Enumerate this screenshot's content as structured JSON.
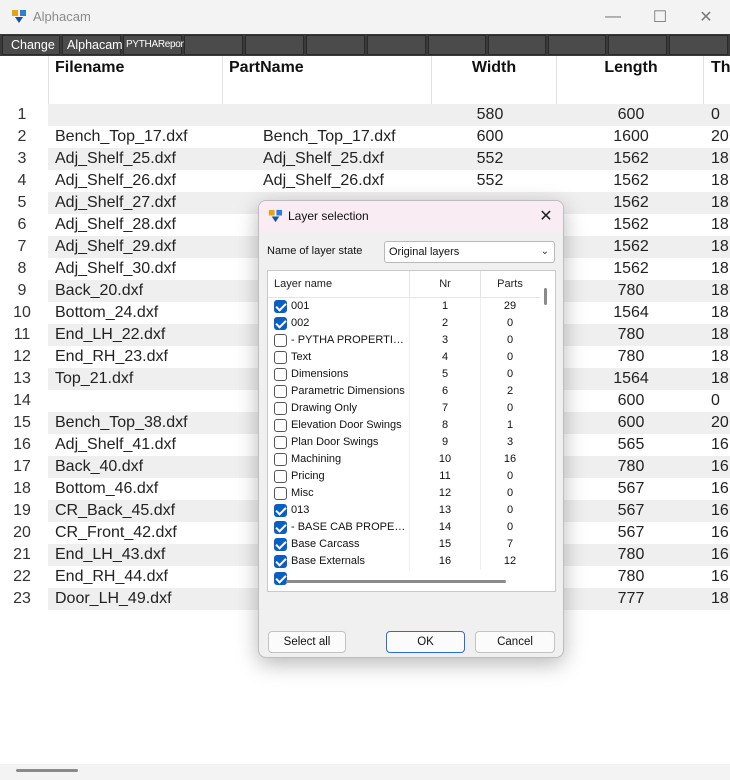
{
  "window": {
    "title": "Alphacam",
    "minimize_glyph": "—",
    "maximize_glyph": "☐",
    "close_glyph": "✕"
  },
  "toolbar": {
    "buttons": [
      "Change",
      "Alphacam",
      "PYTHAReport"
    ]
  },
  "grid": {
    "headers": [
      "Filename",
      "PartName",
      "Width",
      "Length",
      "Th"
    ],
    "rows": [
      {
        "num": "1",
        "file": "",
        "part": "",
        "width": "580",
        "length": "600",
        "th": "0"
      },
      {
        "num": "2",
        "file": "Bench_Top_17.dxf",
        "part": "Bench_Top_17.dxf",
        "width": "600",
        "length": "1600",
        "th": "20"
      },
      {
        "num": "3",
        "file": "Adj_Shelf_25.dxf",
        "part": "Adj_Shelf_25.dxf",
        "width": "552",
        "length": "1562",
        "th": "18"
      },
      {
        "num": "4",
        "file": "Adj_Shelf_26.dxf",
        "part": "Adj_Shelf_26.dxf",
        "width": "552",
        "length": "1562",
        "th": "18"
      },
      {
        "num": "5",
        "file": "Adj_Shelf_27.dxf",
        "part": "",
        "width": "",
        "length": "1562",
        "th": "18"
      },
      {
        "num": "6",
        "file": "Adj_Shelf_28.dxf",
        "part": "",
        "width": "",
        "length": "1562",
        "th": "18"
      },
      {
        "num": "7",
        "file": "Adj_Shelf_29.dxf",
        "part": "",
        "width": "",
        "length": "1562",
        "th": "18"
      },
      {
        "num": "8",
        "file": "Adj_Shelf_30.dxf",
        "part": "",
        "width": "",
        "length": "1562",
        "th": "18"
      },
      {
        "num": "9",
        "file": "Back_20.dxf",
        "part": "",
        "width": "",
        "length": "780",
        "th": "18"
      },
      {
        "num": "10",
        "file": "Bottom_24.dxf",
        "part": "",
        "width": "",
        "length": "1564",
        "th": "18"
      },
      {
        "num": "11",
        "file": "End_LH_22.dxf",
        "part": "",
        "width": "",
        "length": "780",
        "th": "18"
      },
      {
        "num": "12",
        "file": "End_RH_23.dxf",
        "part": "",
        "width": "",
        "length": "780",
        "th": "18"
      },
      {
        "num": "13",
        "file": "Top_21.dxf",
        "part": "",
        "width": "",
        "length": "1564",
        "th": "18"
      },
      {
        "num": "14",
        "file": "",
        "part": "",
        "width": "",
        "length": "600",
        "th": "0"
      },
      {
        "num": "15",
        "file": "Bench_Top_38.dxf",
        "part": "",
        "width": "",
        "length": "600",
        "th": "20"
      },
      {
        "num": "16",
        "file": "Adj_Shelf_41.dxf",
        "part": "",
        "width": "",
        "length": "565",
        "th": "16"
      },
      {
        "num": "17",
        "file": "Back_40.dxf",
        "part": "",
        "width": "",
        "length": "780",
        "th": "16"
      },
      {
        "num": "18",
        "file": "Bottom_46.dxf",
        "part": "",
        "width": "",
        "length": "567",
        "th": "16"
      },
      {
        "num": "19",
        "file": "CR_Back_45.dxf",
        "part": "",
        "width": "",
        "length": "567",
        "th": "16"
      },
      {
        "num": "20",
        "file": "CR_Front_42.dxf",
        "part": "",
        "width": "",
        "length": "567",
        "th": "16"
      },
      {
        "num": "21",
        "file": "End_LH_43.dxf",
        "part": "",
        "width": "",
        "length": "780",
        "th": "16"
      },
      {
        "num": "22",
        "file": "End_RH_44.dxf",
        "part": "",
        "width": "",
        "length": "780",
        "th": "16"
      },
      {
        "num": "23",
        "file": "Door_LH_49.dxf",
        "part": "",
        "width": "",
        "length": "777",
        "th": "18"
      }
    ]
  },
  "dialog": {
    "title": "Layer selection",
    "close_glyph": "✕",
    "layer_state_label": "Name of layer state",
    "layer_state_value": "Original layers",
    "columns": [
      "Layer name",
      "Nr",
      "Parts"
    ],
    "layers": [
      {
        "name": "001",
        "nr": "1",
        "parts": "29",
        "checked": true
      },
      {
        "name": "002",
        "nr": "2",
        "parts": "0",
        "checked": true
      },
      {
        "name": "- PYTHA PROPERTIES -",
        "nr": "3",
        "parts": "0",
        "checked": false
      },
      {
        "name": "Text",
        "nr": "4",
        "parts": "0",
        "checked": false
      },
      {
        "name": "Dimensions",
        "nr": "5",
        "parts": "0",
        "checked": false
      },
      {
        "name": "Parametric Dimensions",
        "nr": "6",
        "parts": "2",
        "checked": false
      },
      {
        "name": "Drawing Only",
        "nr": "7",
        "parts": "0",
        "checked": false
      },
      {
        "name": "Elevation Door Swings",
        "nr": "8",
        "parts": "1",
        "checked": false
      },
      {
        "name": "Plan Door Swings",
        "nr": "9",
        "parts": "3",
        "checked": false
      },
      {
        "name": "Machining",
        "nr": "10",
        "parts": "16",
        "checked": false
      },
      {
        "name": "Pricing",
        "nr": "11",
        "parts": "0",
        "checked": false
      },
      {
        "name": "Misc",
        "nr": "12",
        "parts": "0",
        "checked": false
      },
      {
        "name": "013",
        "nr": "13",
        "parts": "0",
        "checked": true
      },
      {
        "name": "- BASE CAB PROPERT...",
        "nr": "14",
        "parts": "0",
        "checked": true
      },
      {
        "name": "Base Carcass",
        "nr": "15",
        "parts": "7",
        "checked": true
      },
      {
        "name": "Base Externals",
        "nr": "16",
        "parts": "12",
        "checked": true
      }
    ],
    "buttons": {
      "select_all": "Select all",
      "ok": "OK",
      "cancel": "Cancel"
    }
  }
}
